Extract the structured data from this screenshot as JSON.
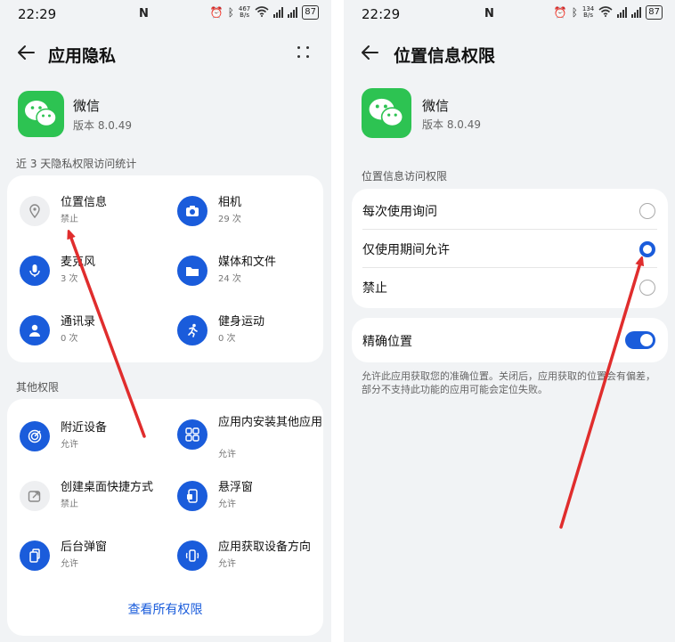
{
  "status": {
    "time": "22:29",
    "nfc": "N",
    "left_speed_value": "467",
    "right_speed_value": "134",
    "speed_unit": "B/s",
    "battery": "87"
  },
  "left": {
    "title": "应用隐私",
    "app": {
      "name": "微信",
      "version": "版本 8.0.49"
    },
    "stats_heading": "近 3 天隐私权限访问统计",
    "stats": [
      {
        "name": "位置信息",
        "status": "禁止"
      },
      {
        "name": "相机",
        "status": "29 次"
      },
      {
        "name": "麦克风",
        "status": "3 次"
      },
      {
        "name": "媒体和文件",
        "status": "24 次"
      },
      {
        "name": "通讯录",
        "status": "0 次"
      },
      {
        "name": "健身运动",
        "status": "0 次"
      }
    ],
    "other_heading": "其他权限",
    "other": [
      {
        "name": "附近设备",
        "status": "允许"
      },
      {
        "name": "应用内安装其他应用",
        "status": "允许"
      },
      {
        "name": "创建桌面快捷方式",
        "status": "禁止"
      },
      {
        "name": "悬浮窗",
        "status": "允许"
      },
      {
        "name": "后台弹窗",
        "status": "允许"
      },
      {
        "name": "应用获取设备方向",
        "status": "允许"
      }
    ],
    "view_all": "查看所有权限"
  },
  "right": {
    "title": "位置信息权限",
    "app": {
      "name": "微信",
      "version": "版本 8.0.49"
    },
    "section_heading": "位置信息访问权限",
    "options": [
      {
        "label": "每次使用询问",
        "selected": false
      },
      {
        "label": "仅使用期间允许",
        "selected": true
      },
      {
        "label": "禁止",
        "selected": false
      }
    ],
    "precise_label": "精确位置",
    "precise_on": true,
    "precise_desc": "允许此应用获取您的准确位置。关闭后，应用获取的位置会有偏差，部分不支持此功能的应用可能会定位失败。"
  },
  "colors": {
    "accent": "#1a5cdb",
    "wechat_green": "#2dc352",
    "annotation_red": "#e02d2d"
  }
}
